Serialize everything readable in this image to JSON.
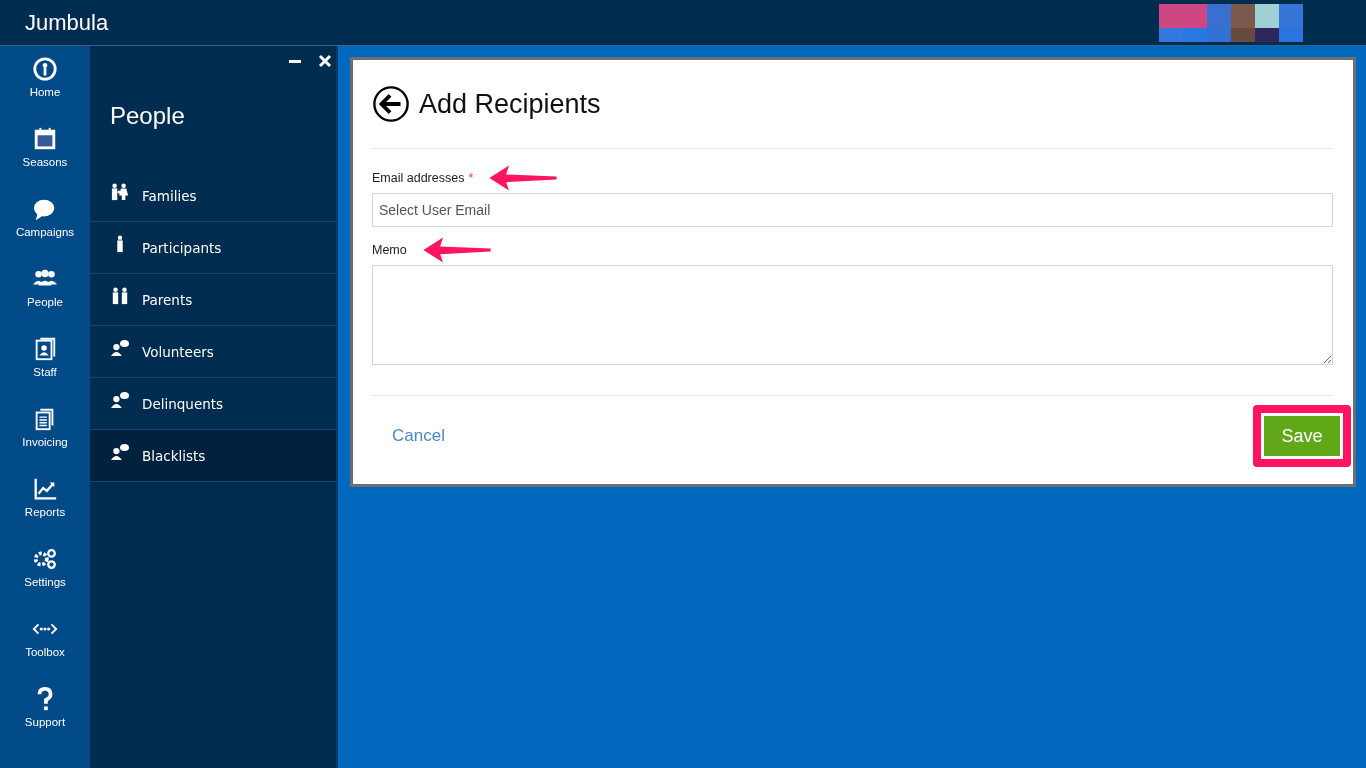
{
  "app": {
    "title": "Jumbula"
  },
  "rail": [
    {
      "label": "Home",
      "kind": "home"
    },
    {
      "label": "Seasons",
      "kind": "calendar"
    },
    {
      "label": "Campaigns",
      "kind": "chat"
    },
    {
      "label": "People",
      "kind": "people"
    },
    {
      "label": "Staff",
      "kind": "staff"
    },
    {
      "label": "Invoicing",
      "kind": "docs"
    },
    {
      "label": "Reports",
      "kind": "chart"
    },
    {
      "label": "Settings",
      "kind": "gears"
    },
    {
      "label": "Toolbox",
      "kind": "code"
    },
    {
      "label": "Support",
      "kind": "help"
    }
  ],
  "panel": {
    "title": "People",
    "items": [
      {
        "label": "Families",
        "kind": "family",
        "selected": false
      },
      {
        "label": "Participants",
        "kind": "person",
        "selected": false
      },
      {
        "label": "Parents",
        "kind": "pair",
        "selected": false
      },
      {
        "label": "Volunteers",
        "kind": "talker",
        "selected": false
      },
      {
        "label": "Delinquents",
        "kind": "talker",
        "selected": false
      },
      {
        "label": "Blacklists",
        "kind": "talker",
        "selected": true
      }
    ]
  },
  "form": {
    "title": "Add Recipients",
    "email": {
      "label": "Email addresses",
      "required_mark": "*",
      "placeholder": "Select User Email"
    },
    "memo": {
      "label": "Memo"
    },
    "cancel": "Cancel",
    "save": "Save"
  }
}
